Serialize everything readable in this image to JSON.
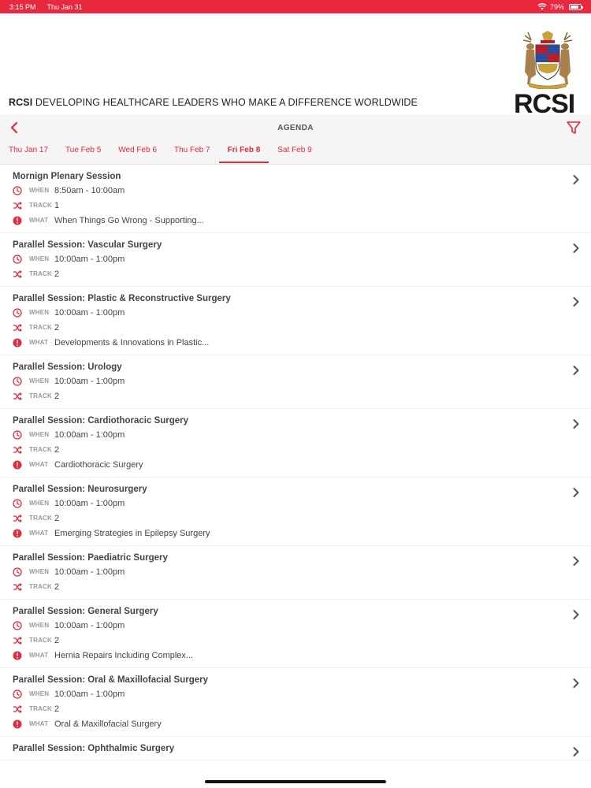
{
  "status": {
    "time": "3:15 PM",
    "date": "Thu Jan 31",
    "battery": "79%"
  },
  "header": {
    "tagline_bold": "RCSI",
    "tagline_rest": " DEVELOPING HEALTHCARE LEADERS WHO MAKE A DIFFERENCE WORLDWIDE",
    "logo_text": "RCSI"
  },
  "nav": {
    "title": "AGENDA"
  },
  "tabs": [
    {
      "label": "Thu Jan 17",
      "active": false
    },
    {
      "label": "Tue Feb 5",
      "active": false
    },
    {
      "label": "Wed Feb 6",
      "active": false
    },
    {
      "label": "Thu Feb 7",
      "active": false
    },
    {
      "label": "Fri Feb 8",
      "active": true
    },
    {
      "label": "Sat Feb 9",
      "active": false
    }
  ],
  "labels": {
    "when": "WHEN",
    "track": "TRACK",
    "what": "WHAT"
  },
  "sessions": [
    {
      "title": "Mornign Plenary Session",
      "when": "8:50am - 10:00am",
      "track": "1",
      "what": "When Things Go Wrong - Supporting..."
    },
    {
      "title": "Parallel Session: Vascular Surgery",
      "when": "10:00am - 1:00pm",
      "track": "2",
      "what": ""
    },
    {
      "title": "Parallel Session: Plastic & Reconstructive Surgery",
      "when": "10:00am - 1:00pm",
      "track": "2",
      "what": "Developments & Innovations in Plastic..."
    },
    {
      "title": "Parallel Session: Urology",
      "when": "10:00am - 1:00pm",
      "track": "2",
      "what": ""
    },
    {
      "title": "Parallel Session: Cardiothoracic Surgery",
      "when": "10:00am - 1:00pm",
      "track": "2",
      "what": "Cardiothoracic Surgery"
    },
    {
      "title": "Parallel Session: Neurosurgery",
      "when": "10:00am - 1:00pm",
      "track": "2",
      "what": "Emerging Strategies in Epilepsy Surgery"
    },
    {
      "title": "Parallel Session: Paediatric Surgery",
      "when": "10:00am - 1:00pm",
      "track": "2",
      "what": ""
    },
    {
      "title": "Parallel Session: General Surgery",
      "when": "10:00am - 1:00pm",
      "track": "2",
      "what": "Hernia Repairs Including Complex..."
    },
    {
      "title": "Parallel Session: Oral & Maxillofacial Surgery",
      "when": "10:00am - 1:00pm",
      "track": "2",
      "what": "Oral & Maxillofacial Surgery"
    },
    {
      "title": "Parallel Session: Ophthalmic Surgery",
      "when": "",
      "track": "",
      "what": ""
    }
  ],
  "colors": {
    "accent": "#e8283c"
  }
}
